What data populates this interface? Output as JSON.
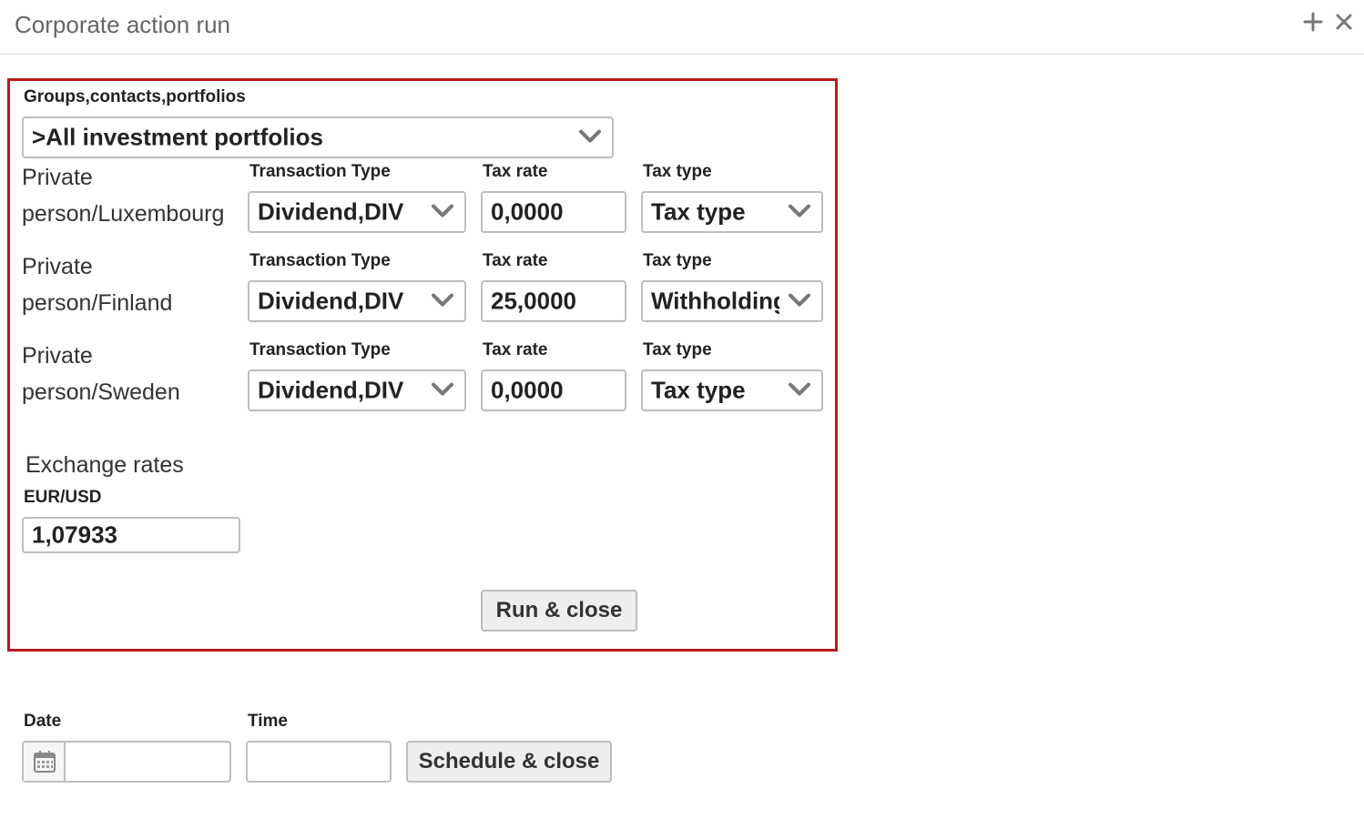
{
  "window": {
    "title": "Corporate action run",
    "add_icon": "plus-icon",
    "close_icon": "close-icon"
  },
  "form": {
    "groups_label": "Groups,contacts,portfolios",
    "groups_value": ">All investment portfolios",
    "rows": [
      {
        "name_line1": "Private",
        "name_line2": "person/Luxembourg",
        "transaction_type_label": "Transaction Type",
        "transaction_type_value": "Dividend,DIV",
        "tax_rate_label": "Tax rate",
        "tax_rate_value": "0,0000",
        "tax_type_label": "Tax type",
        "tax_type_value": "Tax type"
      },
      {
        "name_line1": "Private",
        "name_line2": "person/Finland",
        "transaction_type_label": "Transaction Type",
        "transaction_type_value": "Dividend,DIV",
        "tax_rate_label": "Tax rate",
        "tax_rate_value": "25,0000",
        "tax_type_label": "Tax type",
        "tax_type_value": "Withholding"
      },
      {
        "name_line1": "Private",
        "name_line2": "person/Sweden",
        "transaction_type_label": "Transaction Type",
        "transaction_type_value": "Dividend,DIV",
        "tax_rate_label": "Tax rate",
        "tax_rate_value": "0,0000",
        "tax_type_label": "Tax type",
        "tax_type_value": "Tax type"
      }
    ],
    "exchange_heading": "Exchange rates",
    "exchange_pair": "EUR/USD",
    "exchange_value": "1,07933",
    "run_button": "Run & close"
  },
  "schedule": {
    "date_label": "Date",
    "date_value": "",
    "calendar_icon": "calendar-icon",
    "time_label": "Time",
    "time_value": "",
    "schedule_button": "Schedule & close"
  },
  "colors": {
    "panel_border": "#b51d1d",
    "field_border": "#bdbdbd",
    "button_bg": "#eeeeee"
  }
}
